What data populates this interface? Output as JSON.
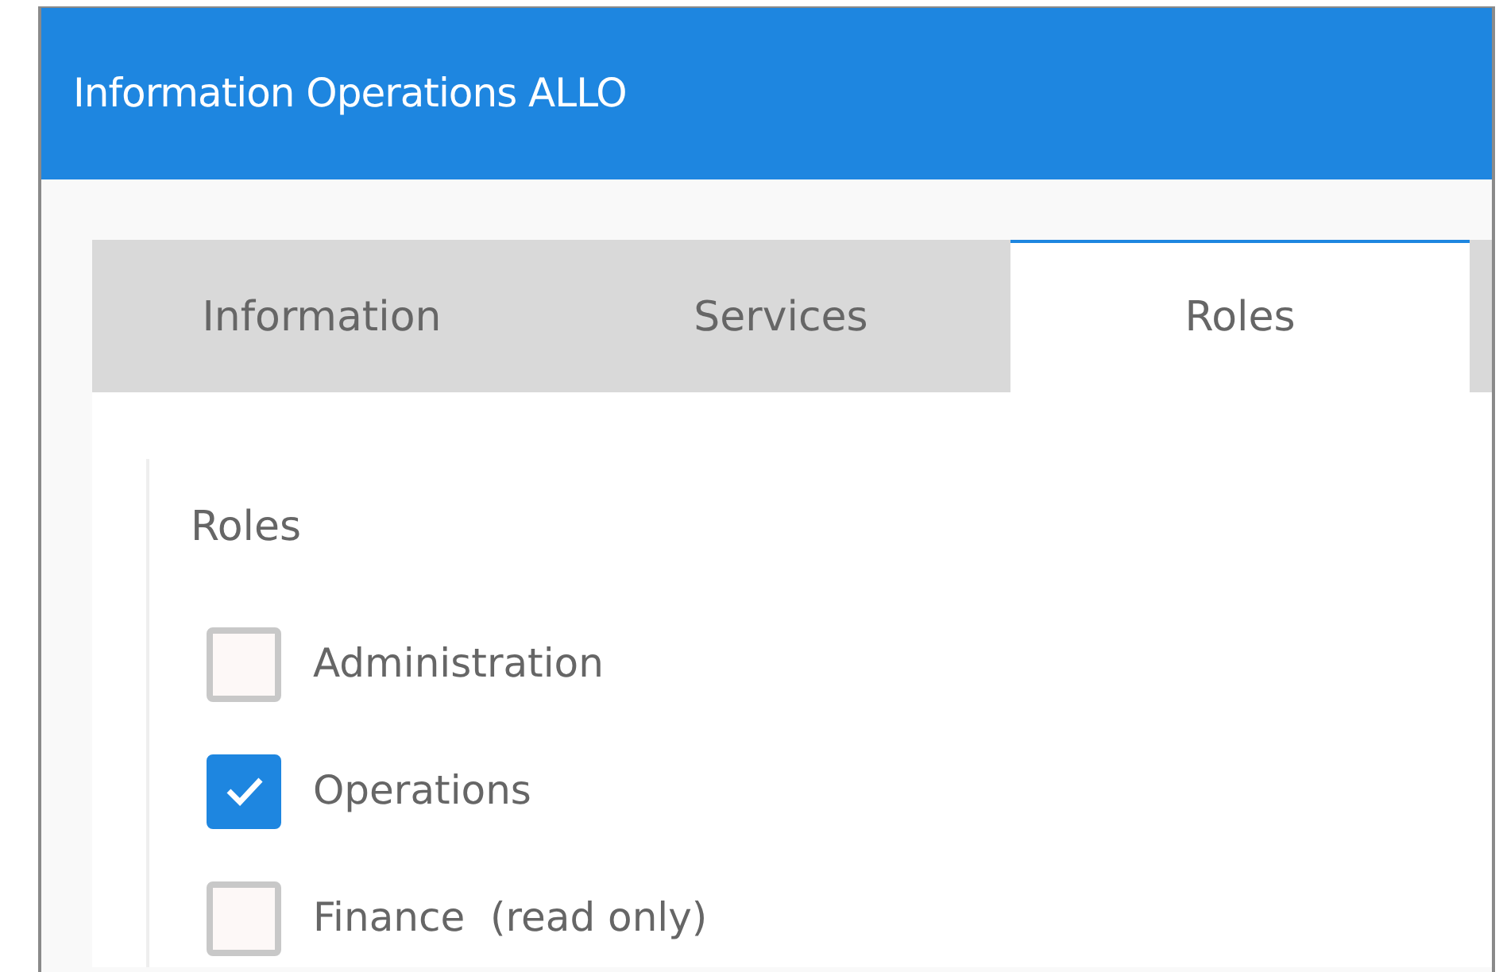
{
  "window": {
    "title": "Information Operations ALLO"
  },
  "tabs": [
    {
      "label": "Information",
      "selected": false
    },
    {
      "label": "Services",
      "selected": false
    },
    {
      "label": "Roles",
      "selected": true
    }
  ],
  "roles": {
    "heading": "Roles",
    "items": [
      {
        "label": "Administration",
        "checked": false
      },
      {
        "label": "Operations",
        "checked": true
      },
      {
        "label": "Finance  (read only)",
        "checked": false
      }
    ]
  }
}
